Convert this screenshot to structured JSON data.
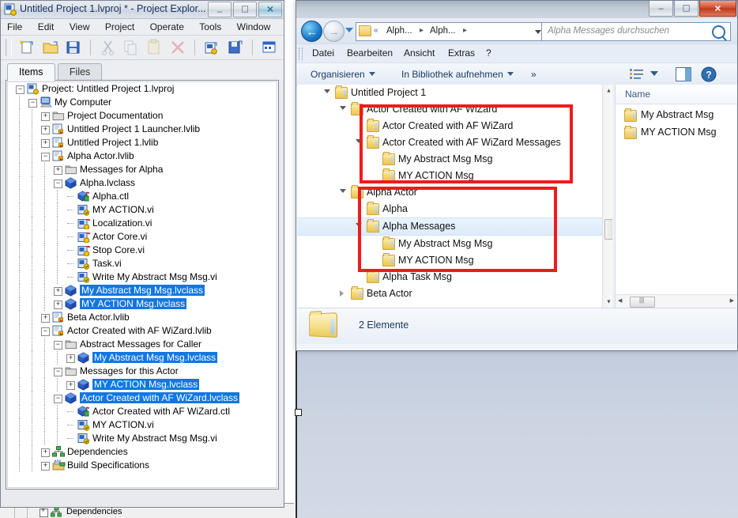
{
  "labview_window": {
    "title": "Untitled Project 1.lvproj * - Project Explor...",
    "title_icon": "labview-project-icon",
    "window_buttons": {
      "minimize": "–",
      "maximize": "❐",
      "close": "✕"
    },
    "menu": [
      "File",
      "Edit",
      "View",
      "Project",
      "Operate",
      "Tools",
      "Window",
      "Help"
    ],
    "toolbar_icons": [
      "new-vi-icon",
      "open-icon",
      "save-all-icon",
      "cut-icon",
      "copy-icon",
      "paste-icon",
      "delete-icon",
      "new-target-icon",
      "save-project-icon",
      "arrange-icon",
      "arrange-dropdown-icon",
      "build-icon",
      "warning-icon"
    ],
    "tabs": [
      {
        "label": "Items",
        "active": true
      },
      {
        "label": "Files",
        "active": false
      }
    ],
    "tree": [
      {
        "label": "Project: Untitled Project 1.lvproj",
        "depth": 0,
        "icon": "project-icon",
        "expander": "minus",
        "selected": false
      },
      {
        "label": "My Computer",
        "depth": 1,
        "icon": "computer-icon",
        "expander": "minus",
        "selected": false
      },
      {
        "label": "Project Documentation",
        "depth": 2,
        "icon": "folder-icon",
        "expander": "plus",
        "selected": false
      },
      {
        "label": "Untitled Project 1 Launcher.lvlib",
        "depth": 2,
        "icon": "lvlib-icon",
        "expander": "plus",
        "selected": false
      },
      {
        "label": "Untitled Project 1.lvlib",
        "depth": 2,
        "icon": "lvlib-icon",
        "expander": "plus",
        "selected": false
      },
      {
        "label": "Alpha Actor.lvlib",
        "depth": 2,
        "icon": "lvlib-icon",
        "expander": "minus",
        "selected": false
      },
      {
        "label": "Messages for Alpha",
        "depth": 3,
        "icon": "folder-icon",
        "expander": "plus",
        "selected": false
      },
      {
        "label": "Alpha.lvclass",
        "depth": 3,
        "icon": "lvclass-icon",
        "expander": "minus",
        "selected": false
      },
      {
        "label": "Alpha.ctl",
        "depth": 4,
        "icon": "ctl-icon",
        "expander": "none",
        "selected": false
      },
      {
        "label": "MY ACTION.vi",
        "depth": 4,
        "icon": "vi-icon",
        "expander": "none",
        "selected": false
      },
      {
        "label": "Localization.vi",
        "depth": 4,
        "icon": "vi-key-icon",
        "expander": "none",
        "selected": false
      },
      {
        "label": "Actor Core.vi",
        "depth": 4,
        "icon": "vi-key-icon",
        "expander": "none",
        "selected": false
      },
      {
        "label": "Stop Core.vi",
        "depth": 4,
        "icon": "vi-key-icon",
        "expander": "none",
        "selected": false
      },
      {
        "label": "Task.vi",
        "depth": 4,
        "icon": "vi-icon",
        "expander": "none",
        "selected": false
      },
      {
        "label": "Write My Abstract Msg Msg.vi",
        "depth": 4,
        "icon": "vi-icon",
        "expander": "none",
        "selected": false
      },
      {
        "label": "My Abstract Msg Msg.lvclass",
        "depth": 3,
        "icon": "lvclass-icon",
        "expander": "plus",
        "selected": true
      },
      {
        "label": "MY ACTION Msg.lvclass",
        "depth": 3,
        "icon": "lvclass-icon",
        "expander": "plus",
        "selected": true
      },
      {
        "label": "Beta Actor.lvlib",
        "depth": 2,
        "icon": "lvlib-icon",
        "expander": "plus",
        "selected": false
      },
      {
        "label": "Actor Created with AF WiZard.lvlib",
        "depth": 2,
        "icon": "lvlib-icon",
        "expander": "minus",
        "selected": false
      },
      {
        "label": "Abstract Messages for Caller",
        "depth": 3,
        "icon": "folder-icon",
        "expander": "minus",
        "selected": false
      },
      {
        "label": "My Abstract Msg Msg.lvclass",
        "depth": 4,
        "icon": "lvclass-icon",
        "expander": "plus",
        "selected": true
      },
      {
        "label": "Messages for this Actor",
        "depth": 3,
        "icon": "folder-icon",
        "expander": "minus",
        "selected": false
      },
      {
        "label": "MY ACTION Msg.lvclass",
        "depth": 4,
        "icon": "lvclass-icon",
        "expander": "plus",
        "selected": true
      },
      {
        "label": "Actor Created with AF WiZard.lvclass",
        "depth": 3,
        "icon": "lvclass-icon",
        "expander": "minus",
        "selected": true
      },
      {
        "label": "Actor Created with AF WiZard.ctl",
        "depth": 4,
        "icon": "ctl-icon",
        "expander": "none",
        "selected": false
      },
      {
        "label": "MY ACTION.vi",
        "depth": 4,
        "icon": "vi-icon",
        "expander": "none",
        "selected": false
      },
      {
        "label": "Write My Abstract Msg Msg.vi",
        "depth": 4,
        "icon": "vi-icon",
        "expander": "none",
        "selected": false
      },
      {
        "label": "Dependencies",
        "depth": 2,
        "icon": "dependencies-icon",
        "expander": "plus",
        "selected": false
      },
      {
        "label": "Build Specifications",
        "depth": 2,
        "icon": "build-specs-icon",
        "expander": "plus",
        "selected": false
      }
    ]
  },
  "background_window": {
    "label": "Dependencies"
  },
  "explorer_window": {
    "window_buttons": {
      "minimize": "–",
      "maximize": "❐",
      "close": "✕"
    },
    "navigation": {
      "back_arrow": "←",
      "forward_arrow": "→",
      "recent_pages_icon": "chevron-down-icon",
      "breadcrumb_overflow": "«",
      "breadcrumb": [
        "Alph...",
        "Alph..."
      ],
      "breadcrumb_separator": "▸",
      "address_dropdown_icon": "chevron-down-icon",
      "refresh_icon": "↻"
    },
    "search": {
      "placeholder": "Alpha Messages durchsuchen",
      "icon": "search-icon"
    },
    "menu": [
      "Datei",
      "Bearbeiten",
      "Ansicht",
      "Extras",
      "?"
    ],
    "toolbar": {
      "organize": "Organisieren",
      "add_to_library": "In Bibliothek aufnehmen",
      "more": "»",
      "view_icon": "list-view-icon",
      "preview_pane_icon": "preview-pane-icon",
      "help_icon": "help-icon"
    },
    "tree": [
      {
        "label": "Untitled Project 1",
        "depth": 0,
        "tri": "open",
        "highlight": false
      },
      {
        "label": "Actor Created with AF WiZard",
        "depth": 1,
        "tri": "open",
        "highlight": false
      },
      {
        "label": "Actor Created with AF WiZard",
        "depth": 2,
        "tri": "none",
        "highlight": false
      },
      {
        "label": "Actor Created with AF WiZard Messages",
        "depth": 2,
        "tri": "open",
        "highlight": false
      },
      {
        "label": "My Abstract Msg Msg",
        "depth": 3,
        "tri": "none",
        "highlight": false
      },
      {
        "label": "MY ACTION Msg",
        "depth": 3,
        "tri": "none",
        "highlight": false
      },
      {
        "label": "Alpha Actor",
        "depth": 1,
        "tri": "open",
        "highlight": false
      },
      {
        "label": "Alpha",
        "depth": 2,
        "tri": "none",
        "highlight": false
      },
      {
        "label": "Alpha Messages",
        "depth": 2,
        "tri": "open",
        "highlight": true
      },
      {
        "label": "My Abstract Msg Msg",
        "depth": 3,
        "tri": "none",
        "highlight": false
      },
      {
        "label": "MY ACTION Msg",
        "depth": 3,
        "tri": "none",
        "highlight": false
      },
      {
        "label": "Alpha Task Msg",
        "depth": 2,
        "tri": "none",
        "highlight": false
      },
      {
        "label": "Beta Actor",
        "depth": 1,
        "tri": "closed",
        "highlight": false
      }
    ],
    "file_list": {
      "column_header": "Name",
      "items": [
        "My Abstract Msg",
        "MY ACTION Msg"
      ]
    },
    "status_bar": {
      "text": "2 Elemente",
      "icon": "folder-open-icon"
    }
  },
  "annotations": {
    "color": "#ee1c1c",
    "boxes": [
      {
        "name": "wizard-group-highlight"
      },
      {
        "name": "alpha-group-highlight"
      }
    ]
  }
}
